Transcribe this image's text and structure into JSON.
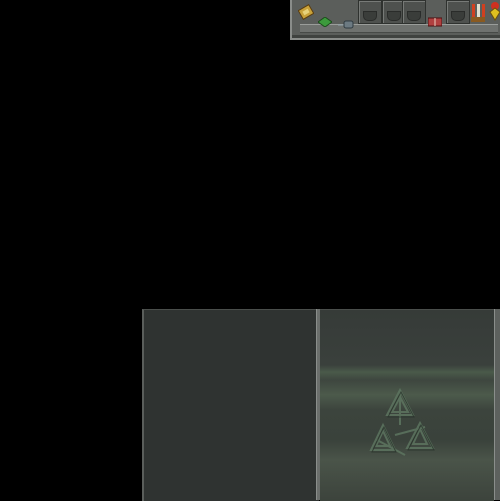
{
  "hotbar": {
    "slots": [
      {
        "icon": "scroll-icon",
        "color": "#c9a23a"
      },
      {
        "icon": "gem-icon",
        "color": "#3c9a3c"
      },
      {
        "icon": "ring-icon",
        "color": "#8fa0a8"
      },
      {
        "icon": "lightning-icon",
        "color": "#3fbf9f"
      },
      {
        "icon": "empty-slot-icon",
        "color": "#3a3d3a"
      },
      {
        "icon": "empty-slot-icon",
        "color": "#3a3d3a"
      },
      {
        "icon": "book-icon",
        "color": "#b04040"
      },
      {
        "icon": "empty-slot-icon",
        "color": "#3a3d3a"
      },
      {
        "icon": "torch-icon",
        "color": "#d04020"
      },
      {
        "icon": "amulet-icon",
        "color": "#e0c020"
      }
    ]
  },
  "panels": {
    "left": {
      "color": "#2f3331"
    },
    "right": {
      "color": "#3a403c",
      "emblem": "triangle-rune-icon"
    }
  }
}
